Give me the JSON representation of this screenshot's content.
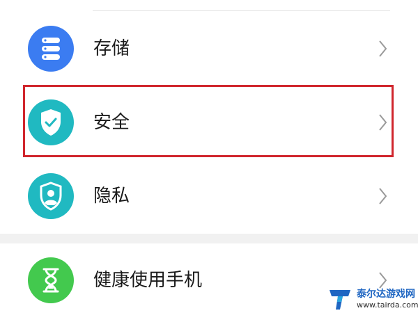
{
  "settings": {
    "items": [
      {
        "label": "存储",
        "icon": "storage-icon",
        "color": "#3b7cf1"
      },
      {
        "label": "安全",
        "icon": "shield-check-icon",
        "color": "#20b9c1"
      },
      {
        "label": "隐私",
        "icon": "privacy-icon",
        "color": "#20b9c1"
      },
      {
        "label": "健康使用手机",
        "icon": "hourglass-icon",
        "color": "#43c94e"
      }
    ],
    "highlighted_item": "安全",
    "highlight_color": "#d0262d"
  },
  "watermark": {
    "title": "泰尔达游戏网",
    "url": "www.tairda.com"
  }
}
